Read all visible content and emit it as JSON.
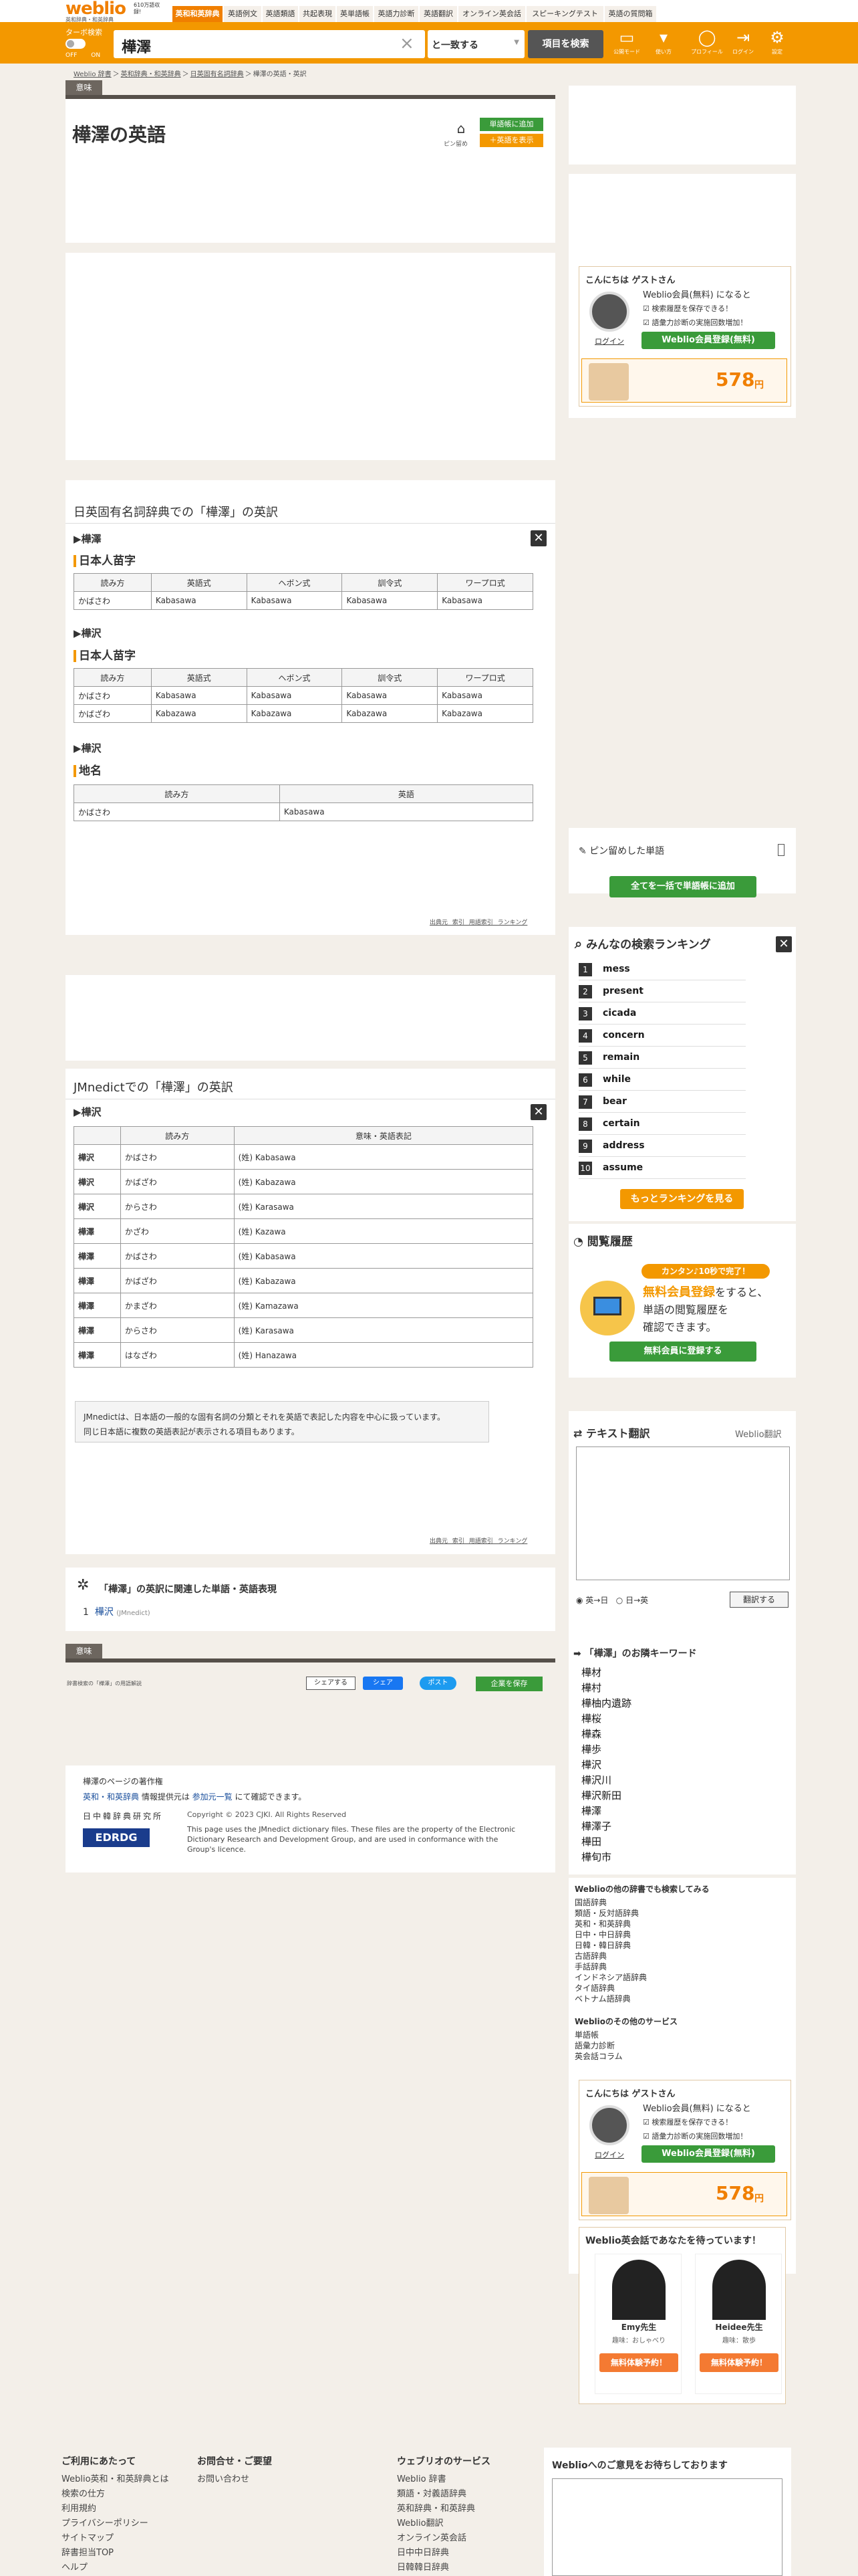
{
  "nav": {
    "logo": "weblio",
    "logo_sub": "英和辞典・和英辞典",
    "promo": "610万語収録!",
    "tabs": [
      "英和和英辞典",
      "英語例文",
      "英語類語",
      "共起表現",
      "英単語帳",
      "英語力診断",
      "英語翻訳",
      "オンライン英会話",
      "スピーキングテスト",
      "英語の質問箱"
    ]
  },
  "search": {
    "quick_label": "ターボ検索",
    "toggle_labels": "OFF ON",
    "query": "樺澤",
    "clear": "×",
    "mode": "と一致する",
    "button": "項目を検索"
  },
  "topicons": [
    {
      "label": "公開モード",
      "glyph": "▭"
    },
    {
      "label": "使い方",
      "glyph": "▾"
    },
    {
      "label": "プロフィール",
      "glyph": "◯"
    },
    {
      "label": "ログイン",
      "glyph": "⇥"
    },
    {
      "label": "設定",
      "glyph": "⚙"
    }
  ],
  "breadcrumb": [
    "Weblio 辞書",
    "＞",
    "英和辞典・和英辞典",
    "＞",
    "日英固有名詞辞典",
    "＞",
    "樺澤の英語・英訳"
  ],
  "tab_label": "意味",
  "page_title": "樺澤の英語",
  "pin_label": "ピン留め",
  "add_word": "単語帳に追加",
  "show_level": "＋英語を表示",
  "sec1": {
    "title": "日英固有名詞辞典での「樺澤」の英訳",
    "entries": [
      {
        "heading": "樺澤",
        "sub": "日本人苗字",
        "cols": [
          "読み方",
          "英語式",
          "ヘボン式",
          "訓令式",
          "ワープロ式"
        ],
        "rows": [
          [
            "かばさわ",
            "Kabasawa",
            "Kabasawa",
            "Kabasawa",
            "Kabasawa"
          ]
        ]
      },
      {
        "heading": "樺沢",
        "sub": "日本人苗字",
        "cols": [
          "読み方",
          "英語式",
          "ヘボン式",
          "訓令式",
          "ワープロ式"
        ],
        "rows": [
          [
            "かばさわ",
            "Kabasawa",
            "Kabasawa",
            "Kabasawa",
            "Kabasawa"
          ],
          [
            "かばざわ",
            "Kabazawa",
            "Kabazawa",
            "Kabazawa",
            "Kabazawa"
          ]
        ]
      },
      {
        "heading": "樺沢",
        "sub": "地名",
        "cols": [
          "読み方",
          "英語"
        ],
        "rows": [
          [
            "かばさわ",
            "Kabasawa"
          ]
        ]
      }
    ],
    "links": "出典元 索引 用語索引 ランキング"
  },
  "sec2": {
    "title": "JMnedictでの「樺澤」の英訳",
    "heading": "樺沢",
    "cols": [
      "",
      "読み方",
      "意味・英語表記"
    ],
    "rows": [
      [
        "樺沢",
        "かばさわ",
        "(姓) Kabasawa"
      ],
      [
        "樺沢",
        "かばざわ",
        "(姓) Kabazawa"
      ],
      [
        "樺沢",
        "からさわ",
        "(姓) Karasawa"
      ],
      [
        "樺澤",
        "かざわ",
        "(姓) Kazawa"
      ],
      [
        "樺澤",
        "かばさわ",
        "(姓) Kabasawa"
      ],
      [
        "樺澤",
        "かばざわ",
        "(姓) Kabazawa"
      ],
      [
        "樺澤",
        "かまざわ",
        "(姓) Kamazawa"
      ],
      [
        "樺澤",
        "からさわ",
        "(姓) Karasawa"
      ],
      [
        "樺澤",
        "はなざわ",
        "(姓) Hanazawa"
      ]
    ],
    "note1": "JMnedictは、日本語の一般的な固有名詞の分類とそれを英語で表記した内容を中心に扱っています。",
    "note2": "同じ日本語に複数の英語表記が表示される項目もあります。",
    "links": "出典元 索引 用語索引 ランキング"
  },
  "related": {
    "title": "「樺澤」の英訳に関連した単語・英語表現",
    "item_no": "1",
    "item": "樺沢",
    "item_src": "(JMnedict)"
  },
  "share": {
    "label": "シェアする",
    "fb": "シェア",
    "tw": "ポスト",
    "save": "企業を保存"
  },
  "copyright_small": "辞書検索の「樺澤」の用語解説",
  "copyright": {
    "title": "樺澤のページの著作権",
    "line1a": "英和・和英辞典",
    "line1b": " 情報提供元は ",
    "line1c": "参加元一覧",
    "line1d": " にて確認できます。",
    "org": "日中韓辞典研究所",
    "c2023": "Copyright © 2023 CJKI. All Rights Reserved",
    "edrdg": "EDRDG",
    "edrdg_text": "This page uses the JMnedict dictionary files. These files are the property of the Electronic Dictionary Research and Development Group, and are used in conformance with the Group's licence."
  },
  "side": {
    "greeting": "こんにちは ゲストさん",
    "member_line": "Weblio会員(無料) になると",
    "benefit1": "検索履歴を保存できる！",
    "benefit2": "語彙力診断の実施回数増加！",
    "login": "ログイン",
    "register": "Weblio会員登録(無料)",
    "ad_price": "578",
    "ad_unit": "円",
    "pin_title": "ピン留めした単語",
    "pin_btn": "全てを一括で単語帳に追加",
    "rank_title": "みんなの検索ランキング",
    "ranking": [
      "mess",
      "present",
      "cicada",
      "concern",
      "remain",
      "while",
      "bear",
      "certain",
      "address",
      "assume"
    ],
    "rank_more": "もっとランキングを見る",
    "history_title": "閲覧履歴",
    "history_badge": "カンタン♪10秒で完了！",
    "history_free": "無料会員登録",
    "history_text1": "をすると、",
    "history_text2": "単語の閲覧履歴を",
    "history_text3": "確認できます。",
    "history_btn": "無料会員に登録する",
    "translate_title": "テキスト翻訳",
    "translate_brand": "Weblio翻訳",
    "opt1": "英→日",
    "opt2": "日→英",
    "translate_btn": "翻訳する",
    "kw_title": "「樺澤」のお隣キーワード",
    "keywords": [
      "樺材",
      "樺村",
      "樺柚内遺跡",
      "樺桜",
      "樺森",
      "樺歩",
      "樺沢",
      "樺沢川",
      "樺沢新田",
      "樺澤",
      "樺澤子",
      "樺田",
      "樺旬市"
    ],
    "other_title": "Weblioの他の辞書でも検索してみる",
    "other": [
      "国語辞典",
      "類語・反対語辞典",
      "英和・和英辞典",
      "日中・中日辞典",
      "日韓・韓日辞典",
      "古語辞典",
      "手話辞典",
      "インドネシア語辞典",
      "タイ語辞典",
      "ベトナム語辞典"
    ],
    "svc_title": "Weblioのその他のサービス",
    "svc": [
      "単語帳",
      "語彙力診断",
      "英会話コラム"
    ],
    "eikaiwa_title": "Weblio英会話であなたを待っています！",
    "t1_name": "Emy先生",
    "t1_hobby": "趣味：おしゃべり",
    "t1_btn": "無料体験予約！",
    "t2_name": "Heidee先生",
    "t2_hobby": "趣味：散歩",
    "t2_btn": "無料体験予約！"
  },
  "footer": {
    "col1_title": "ご利用にあたって",
    "col1": [
      "Weblio英和・和英辞典とは",
      "検索の仕方",
      "利用規約",
      "プライバシーポリシー",
      "サイトマップ",
      "辞書担当TOP",
      "ヘルプ"
    ],
    "col2_title": "お問合せ・ご要望",
    "col2": [
      "お問い合わせ"
    ],
    "col3_title": "ウェブリオのサービス",
    "col3": [
      "Weblio 辞書",
      "類語・対義語辞典",
      "英和辞典・和英辞典",
      "Weblio翻訳",
      "オンライン英会話",
      "日中中日辞典",
      "日韓韓日辞典"
    ],
    "feedback_title": "Weblioへのご意見をお待ちしております"
  }
}
